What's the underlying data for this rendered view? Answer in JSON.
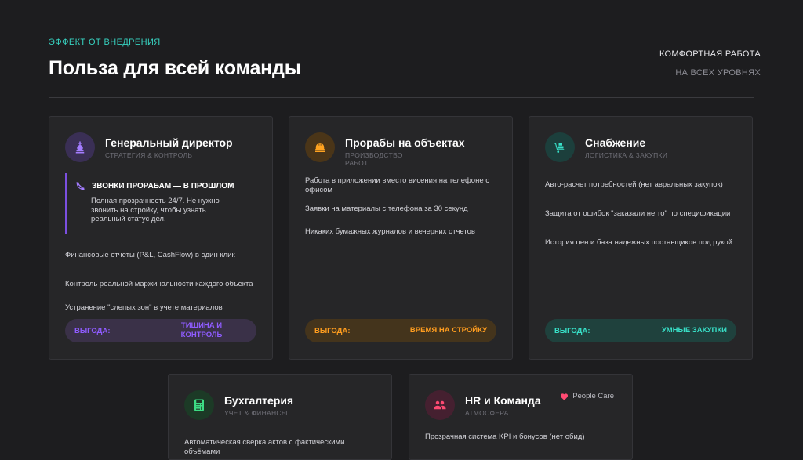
{
  "header": {
    "eyebrow": "ЭФФЕКТ ОТ ВНЕДРЕНИЯ",
    "title": "Польза для всей команды",
    "tag_primary": "КОМФОРТНАЯ РАБОТА",
    "tag_secondary": "НА ВСЕХ УРОВНЯХ"
  },
  "colors": {
    "purple": "#8f5cff",
    "orange": "#ff9d1f",
    "teal": "#38e0c8",
    "green": "#3ddc84",
    "red": "#ff4a72"
  },
  "cards": {
    "director": {
      "icon": "chess-king-icon",
      "title": "Генеральный директор",
      "subtitle": "СТРАТЕГИЯ & КОНТРОЛЬ",
      "quote_icon": "phone-slash-icon",
      "quote_title": "ЗВОНКИ ПРОРАБАМ — В ПРОШЛОМ",
      "quote_text": "Полная прозрачность 24/7. Не нужно звонить на стройку, чтобы узнать реальный статус дел.",
      "items": [
        "Финансовые отчеты (P&L, CashFlow) в один клик",
        "Контроль реальной маржинальности каждого объекта",
        "Устранение \"слепых зон\" в учете материалов"
      ],
      "benefit_label": "ВЫГОДА:",
      "benefit_value": "ТИШИНА И КОНТРОЛЬ"
    },
    "foremen": {
      "icon": "hard-hat-icon",
      "title": "Прорабы на объектах",
      "subtitle": "ПРОИЗВОДСТВО РАБОТ",
      "items": [
        "Работа в приложении вместо висения на телефоне с офисом",
        "Заявки на материалы с телефона за 30 секунд",
        "Никаких бумажных журналов и вечерних отчетов"
      ],
      "benefit_label": "ВЫГОДА:",
      "benefit_value": "ВРЕМЯ НА СТРОЙКУ"
    },
    "supply": {
      "icon": "dolly-icon",
      "title": "Снабжение",
      "subtitle": "ЛОГИСТИКА & ЗАКУПКИ",
      "items": [
        "Авто-расчет потребностей (нет авральных закупок)",
        "Защита от ошибок \"заказали не то\" по спецификации",
        "История цен и база надежных поставщиков под рукой"
      ],
      "benefit_label": "ВЫГОДА:",
      "benefit_value": "УМНЫЕ ЗАКУПКИ"
    },
    "accounting": {
      "icon": "calculator-icon",
      "title": "Бухгалтерия",
      "subtitle": "УЧЕТ & ФИНАНСЫ",
      "items": [
        "Автоматическая сверка актов с фактическими объёмами"
      ]
    },
    "hr": {
      "icon": "users-icon",
      "title": "HR и Команда",
      "subtitle": "АТМОСФЕРА",
      "badge_icon": "heart-icon",
      "badge": "People Care",
      "items": [
        "Прозрачная система KPI и бонусов (нет обид)"
      ]
    }
  }
}
